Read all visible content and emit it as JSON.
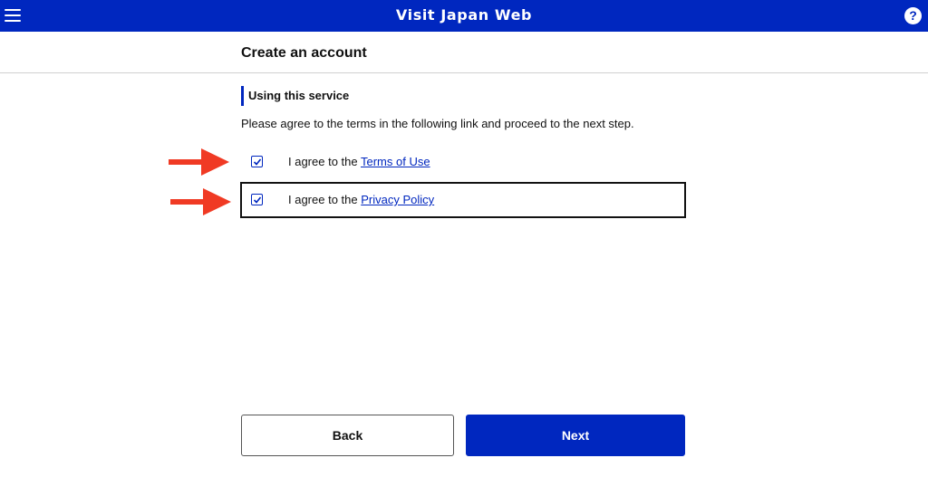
{
  "header": {
    "title": "Visit Japan Web",
    "help_glyph": "?",
    "background_color": "#0027bf",
    "menu_icon": "hamburger-menu-icon",
    "help_icon": "question-circle-icon"
  },
  "page": {
    "title": "Create an account"
  },
  "section": {
    "heading": "Using this service",
    "accent_color": "#0027bf",
    "instruction": "Please agree to the terms in the following link and proceed to the next step."
  },
  "agreements": [
    {
      "prefix": "I agree to the ",
      "link_label": "Terms of Use",
      "checked": true
    },
    {
      "prefix": "I agree to the ",
      "link_label": "Privacy Policy",
      "checked": true,
      "focused": true
    }
  ],
  "annotations": {
    "arrow_color": "#f03a24",
    "arrow_icon": "red-arrow-right-icon"
  },
  "buttons": {
    "back_label": "Back",
    "next_label": "Next",
    "next_color": "#0027bf"
  }
}
